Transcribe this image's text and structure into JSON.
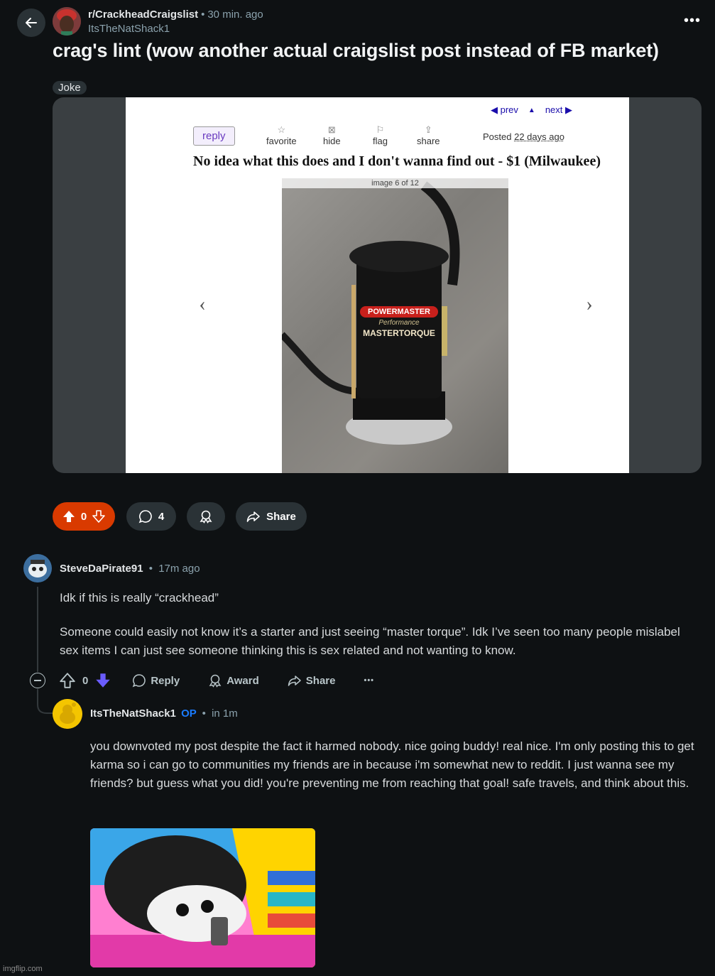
{
  "header": {
    "subreddit": "r/CrackheadCraigslist",
    "separator": "•",
    "time": "30 min. ago",
    "author": "ItsTheNatShack1",
    "more": "•••"
  },
  "post": {
    "title": "crag's lint (wow another actual craigslist post instead of FB market)",
    "flair": "Joke"
  },
  "craigslist": {
    "prev": "prev",
    "up": "▲",
    "next": "next",
    "reply": "reply",
    "favorite": "favorite",
    "hide": "hide",
    "flag": "flag",
    "share": "share",
    "posted_label": "Posted",
    "posted_value": "22 days ago",
    "title": "No idea what this does and I don't wanna find out - $1 (Milwaukee)",
    "image_counter": "image 6 of 12",
    "product_brand": "POWERMASTER",
    "product_sub": "Performance",
    "product_name": "MASTERTORQUE"
  },
  "actions": {
    "votes": "0",
    "comments": "4",
    "share": "Share"
  },
  "comments": [
    {
      "author": "SteveDaPirate91",
      "separator": "•",
      "time": "17m ago",
      "paragraphs": [
        "Idk if this is really “crackhead”",
        "Someone could easily not know it’s a starter and just seeing “master torque”. Idk I’ve seen too many people mislabel sex items I can just see someone thinking this is sex related and not wanting to know."
      ],
      "votes": "0",
      "reply": "Reply",
      "award": "Award",
      "share": "Share",
      "more": "•••"
    },
    {
      "author": "ItsTheNatShack1",
      "op": "OP",
      "separator": "•",
      "time": "in 1m",
      "paragraphs": [
        "you downvoted my post despite the fact it harmed nobody. nice going buddy! real nice. I'm only posting this to get karma so i can go to communities my friends are in because i'm somewhat new to reddit. I just wanna see my friends? but guess what you did! you're preventing me from reaching that goal! safe travels, and think about this."
      ]
    }
  ],
  "watermark": "imgflip.com",
  "colors": {
    "background": "#0e1113",
    "upvote_active": "#d93a00",
    "op_badge": "#1a7cff",
    "downvote_active": "#6a5cff"
  }
}
